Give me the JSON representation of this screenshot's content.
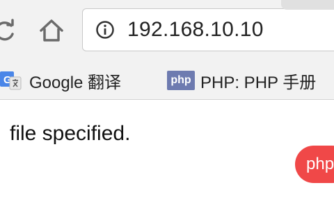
{
  "toolbar": {
    "reload_icon": "reload-icon",
    "home_icon": "home-icon",
    "info_icon": "info-icon",
    "url": "192.168.10.10"
  },
  "bookmarks": [
    {
      "label": "Google 翻译",
      "icon": "google-translate-icon"
    },
    {
      "label": "PHP: PHP 手册",
      "icon": "php-icon",
      "icon_text": "php"
    }
  ],
  "page": {
    "text": "file specified."
  },
  "watermark": {
    "text": "php"
  },
  "colors": {
    "toolbar_bg": "#f2f2f2",
    "php_icon_bg": "#6e7bb0",
    "watermark_bg": "#f04848"
  }
}
